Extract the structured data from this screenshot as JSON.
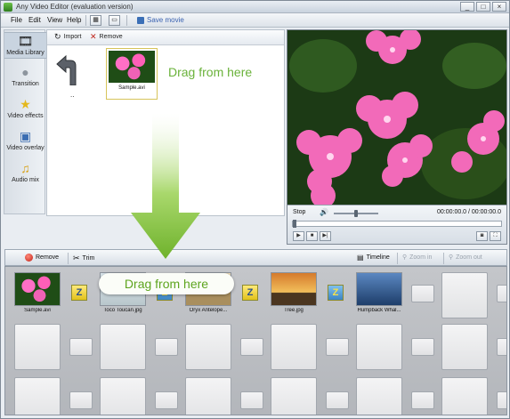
{
  "window": {
    "title": "Any Video Editor (evaluation version)",
    "controls": [
      "_",
      "□",
      "×"
    ]
  },
  "menubar": {
    "items": [
      "File",
      "Edit",
      "View",
      "Help"
    ],
    "save_label": "Save movie"
  },
  "sidebar": {
    "items": [
      {
        "label": "Media Library",
        "icon": "film-strip-icon"
      },
      {
        "label": "Transition",
        "icon": "transition-disc-icon"
      },
      {
        "label": "Video effects",
        "icon": "star-effects-icon"
      },
      {
        "label": "Video overlay",
        "icon": "overlay-icon"
      },
      {
        "label": "Audio mix",
        "icon": "music-note-icon"
      }
    ]
  },
  "library": {
    "import_label": "Import",
    "remove_label": "Remove",
    "up_label": "..",
    "file_name": "Sample.avi",
    "drag_hint": "Drag from here"
  },
  "preview": {
    "stop_label": "Stop",
    "time_text": "00:00:00.0 / 00:00:00.0",
    "volume_fraction": 0.5
  },
  "timeline_toolbar": {
    "remove_label": "Remove",
    "trim_label": "Trim",
    "timeline_label": "Timeline",
    "zoom_in_label": "Zoom in",
    "zoom_out_label": "Zoom out"
  },
  "storyboard": {
    "clips": [
      {
        "caption": "Sample.avi"
      },
      {
        "caption": "Toco Toucan.jpg"
      },
      {
        "caption": "Oryx Antelope..."
      },
      {
        "caption": "Tree.jpg"
      },
      {
        "caption": "Humpback Whal..."
      }
    ],
    "drag_hint": "Drag from here"
  },
  "colors": {
    "hint_green": "#6ab23a",
    "accent_blue": "#3a62b0"
  }
}
